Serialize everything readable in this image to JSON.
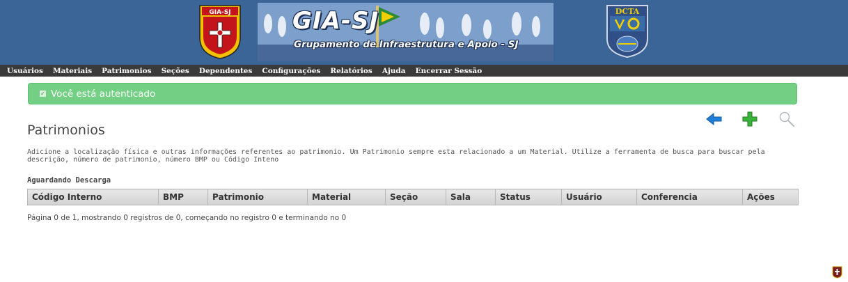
{
  "header": {
    "shield_label": "GIA-SJ",
    "title": "GIA-SJ",
    "subtitle": "Grupamento de Infraestrutura e Apoio - SJ",
    "dcta_label": "DCTA",
    "banner_color": "#3a6596"
  },
  "menu": {
    "items": [
      {
        "label": "Usuários"
      },
      {
        "label": "Materiais"
      },
      {
        "label": "Patrimonios"
      },
      {
        "label": "Seções"
      },
      {
        "label": "Dependentes"
      },
      {
        "label": "Configurações"
      },
      {
        "label": "Relatórios"
      },
      {
        "label": "Ajuda"
      },
      {
        "label": "Encerrar Sessão"
      }
    ]
  },
  "alert": {
    "text": "Você está autenticado",
    "color": "#72cf83"
  },
  "toolbar": {
    "icons": [
      "back-arrow-icon",
      "add-plus-icon",
      "search-magnifier-icon"
    ]
  },
  "page": {
    "title": "Patrimonios",
    "description": "Adicione a localização física e outras informações referentes ao patrimonio. Um Patrimonio sempre esta relacionado a um Material. Utilize a ferramenta de busca para buscar pela descrição, número de patrimonio, número BMP ou Código Inteno",
    "section_label": "Aguardando Descarga"
  },
  "table": {
    "columns": [
      "Código Interno",
      "BMP",
      "Patrimonio",
      "Material",
      "Seção",
      "Sala",
      "Status",
      "Usuário",
      "Conferencia",
      "Ações"
    ],
    "rows": []
  },
  "pagination": {
    "text": "Página 0 de 1, mostrando 0 registros de 0, começando no registro 0 e terminando no 0"
  }
}
